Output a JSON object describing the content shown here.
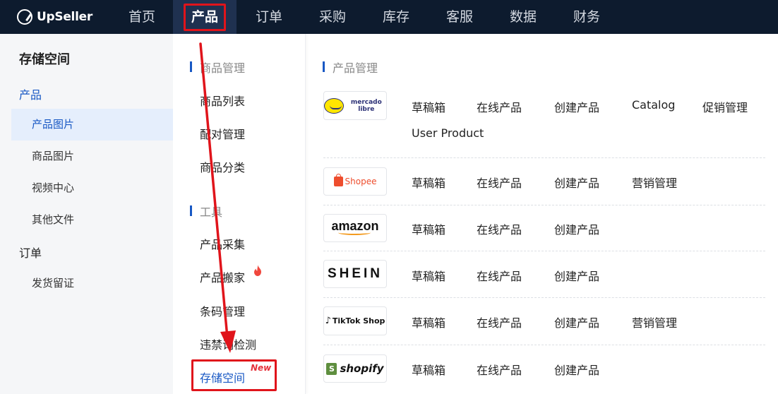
{
  "app": {
    "logo_text": "UpSeller"
  },
  "nav": {
    "items": [
      "首页",
      "产品",
      "订单",
      "采购",
      "库存",
      "客服",
      "数据",
      "财务"
    ],
    "active_index": 1
  },
  "sidebar": {
    "title": "存储空间",
    "groups": [
      {
        "label": "产品",
        "items": [
          "产品图片",
          "商品图片",
          "视频中心",
          "其他文件"
        ]
      },
      {
        "label": "订单",
        "items": [
          "发货留证"
        ]
      }
    ],
    "active_item": "产品图片"
  },
  "dropdown": {
    "sections": [
      {
        "header": "商品管理",
        "items": [
          "商品列表",
          "配对管理",
          "商品分类"
        ]
      },
      {
        "header": "工具",
        "items": [
          "产品采集",
          "产品搬家",
          "条码管理",
          "违禁词检测",
          "存储空间"
        ]
      }
    ],
    "hot_item": "产品搬家",
    "new_item": "存储空间",
    "new_badge": "New"
  },
  "product_panel": {
    "header": "产品管理",
    "platforms": [
      {
        "logo_name": "mercado-libre",
        "logo_text": "mercado libre",
        "links": [
          "草稿箱",
          "在线产品",
          "创建产品",
          "Catalog",
          "促销管理",
          "User Product"
        ]
      },
      {
        "logo_name": "shopee",
        "logo_text": "Shopee",
        "links": [
          "草稿箱",
          "在线产品",
          "创建产品",
          "营销管理"
        ]
      },
      {
        "logo_name": "amazon",
        "logo_text": "amazon",
        "links": [
          "草稿箱",
          "在线产品",
          "创建产品"
        ]
      },
      {
        "logo_name": "shein",
        "logo_text": "SHEIN",
        "links": [
          "草稿箱",
          "在线产品",
          "创建产品"
        ]
      },
      {
        "logo_name": "tiktok-shop",
        "logo_text": "TikTok Shop",
        "links": [
          "草稿箱",
          "在线产品",
          "创建产品",
          "营销管理"
        ]
      },
      {
        "logo_name": "shopify",
        "logo_text": "shopify",
        "links": [
          "草稿箱",
          "在线产品",
          "创建产品"
        ]
      }
    ]
  },
  "colors": {
    "topbar": "#0d1b2e",
    "accent_blue": "#1858c4",
    "annotation_red": "#e0141b",
    "sidebar_bg": "#f5f6f8"
  }
}
